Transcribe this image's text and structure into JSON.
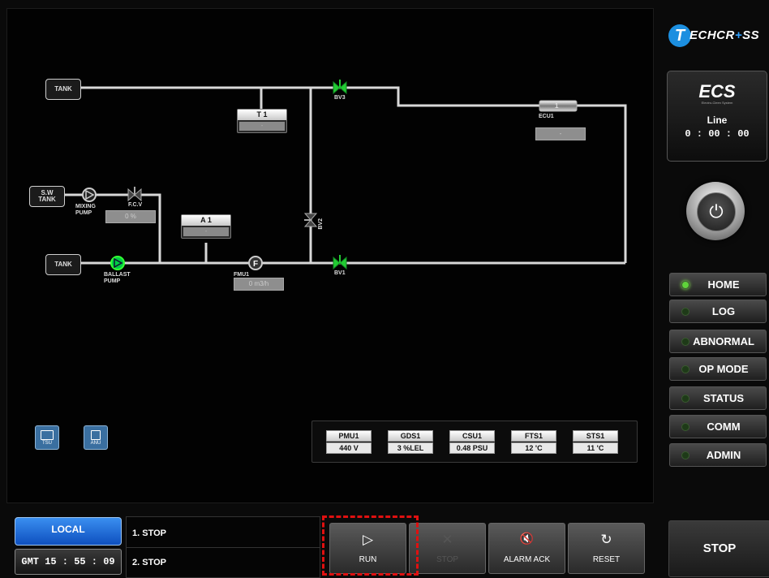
{
  "diagram": {
    "tanks": [
      "TANK",
      "S.W\nTANK",
      "TANK"
    ],
    "labels": {
      "bv3": "BV3",
      "bv2": "BV2",
      "bv1": "BV1",
      "fcv": "F.C.V",
      "mixing_pump": "MIXING\nPUMP",
      "ballast_pump": "BALLAST\nPUMP",
      "fmu1": "FMU1",
      "ecu1": "ECU1",
      "ecu_num": "1"
    },
    "t1": {
      "title": "T 1",
      "value": "-"
    },
    "a1": {
      "title": "A 1",
      "value": "-"
    },
    "ecu_value": "-",
    "fcv_value": "0 %",
    "fmu_value": "0 m3/h"
  },
  "sensors": [
    {
      "name": "PMU1",
      "value": "440 V"
    },
    {
      "name": "GDS1",
      "value": "3 %LEL"
    },
    {
      "name": "CSU1",
      "value": "0.48 PSU"
    },
    {
      "name": "FTS1",
      "value": "12 'C"
    },
    {
      "name": "STS1",
      "value": "11 'C"
    }
  ],
  "mini_icons": [
    "TSU",
    "ANU"
  ],
  "logo": {
    "letter": "T",
    "text_a": "ECHCR",
    "text_plus": "+",
    "text_b": "SS"
  },
  "ecs": {
    "mark": "ECS",
    "sub": "Electro-Cleen System",
    "line": "Line",
    "time": "0 : 00 : 00"
  },
  "menu": [
    {
      "label": "HOME",
      "active": true
    },
    {
      "label": "LOG",
      "active": false
    },
    {
      "label": "ABNORMAL",
      "active": false
    },
    {
      "label": "OP MODE",
      "active": false
    },
    {
      "label": "STATUS",
      "active": false
    },
    {
      "label": "COMM",
      "active": false
    },
    {
      "label": "ADMIN",
      "active": false
    }
  ],
  "bottom": {
    "local": "LOCAL",
    "gmt": "GMT 15 : 55 : 09",
    "status1": "1. STOP",
    "status2": "2. STOP",
    "controls": [
      {
        "icon": "play-icon",
        "glyph": "▷",
        "label": "RUN",
        "enabled": true
      },
      {
        "icon": "stop-x-icon",
        "glyph": "✕",
        "label": "STOP",
        "enabled": false
      },
      {
        "icon": "mute-alarm-icon",
        "glyph": "🔇",
        "label": "ALARM ACK",
        "enabled": true
      },
      {
        "icon": "reset-icon",
        "glyph": "↻",
        "label": "RESET",
        "enabled": true
      }
    ],
    "big_stop": "STOP"
  },
  "colors": {
    "accent_blue": "#1c8fe0",
    "valve_green": "#22cc33",
    "highlight_red": "#e01010"
  }
}
